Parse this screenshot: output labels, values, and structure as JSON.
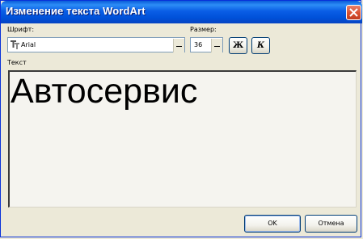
{
  "window": {
    "title": "Изменение текста WordArt"
  },
  "labels": {
    "font": "Шрифт:",
    "size": "Размер:",
    "text": "Текст"
  },
  "font_combo": {
    "value": "Arial",
    "icon": "truetype-font-icon"
  },
  "size_combo": {
    "value": "36"
  },
  "format": {
    "bold": "Ж",
    "italic": "К"
  },
  "content": {
    "text": "Автосервис"
  },
  "buttons": {
    "ok": "OK",
    "cancel": "Отмена"
  }
}
